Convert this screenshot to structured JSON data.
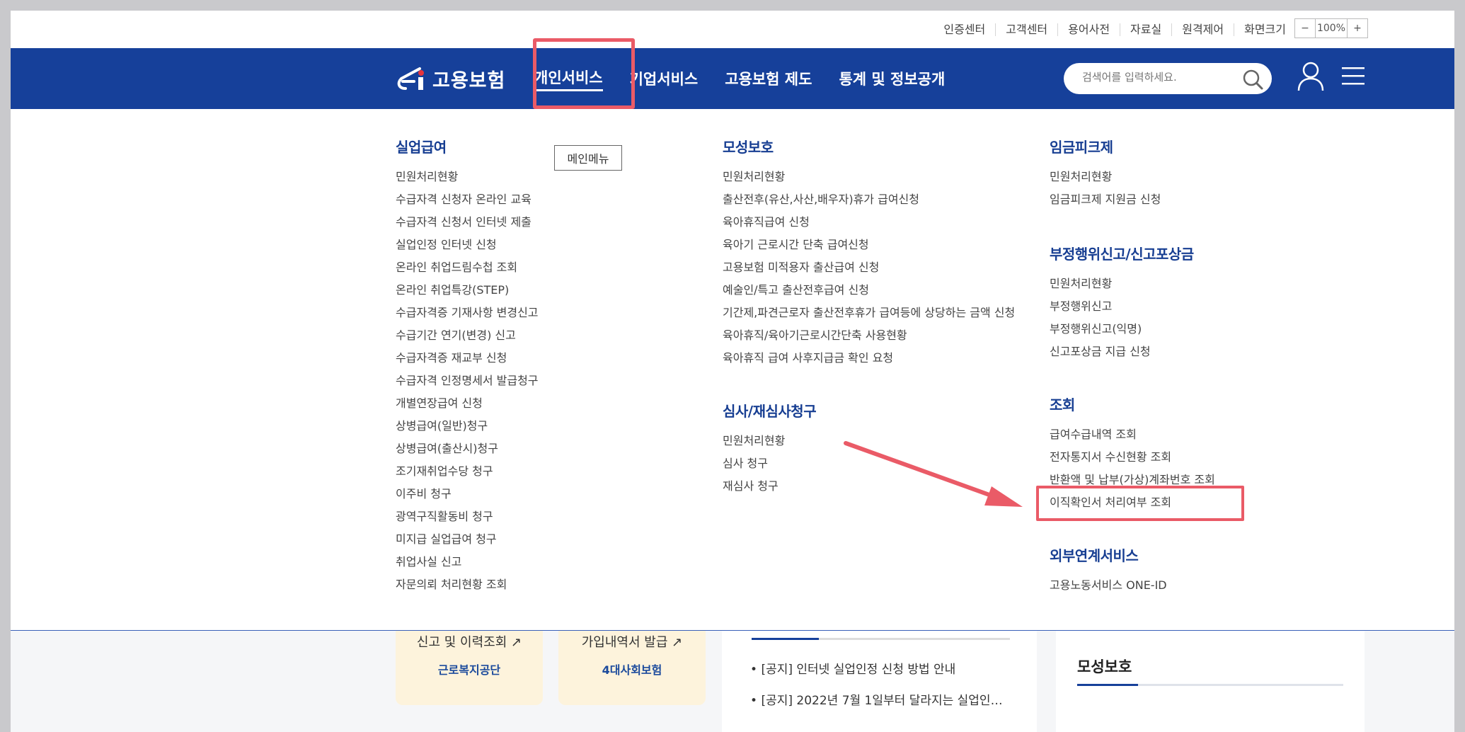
{
  "util_links": [
    "인증센터",
    "고객센터",
    "용어사전",
    "자료실",
    "원격제어",
    "화면크기"
  ],
  "zoom": {
    "minus": "−",
    "value": "100%",
    "plus": "+"
  },
  "logo_text": "고용보험",
  "nav": [
    "개인서비스",
    "기업서비스",
    "고용보험 제도",
    "통계 및 정보공개"
  ],
  "search": {
    "placeholder": "검색어를 입력하세요."
  },
  "main_menu_label": "메인메뉴",
  "menu": {
    "col1": {
      "title": "실업급여",
      "items": [
        "민원처리현황",
        "수급자격 신청자 온라인 교육",
        "수급자격 신청서 인터넷 제출",
        "실업인정 인터넷 신청",
        "온라인 취업드림수첩 조회",
        "온라인 취업특강(STEP)",
        "수급자격증 기재사항 변경신고",
        "수급기간 연기(변경) 신고",
        "수급자격증 재교부 신청",
        "수급자격 인정명세서 발급청구",
        "개별연장급여 신청",
        "상병급여(일반)청구",
        "상병급여(출산시)청구",
        "조기재취업수당 청구",
        "이주비 청구",
        "광역구직활동비 청구",
        "미지급 실업급여 청구",
        "취업사실 신고",
        "자문의뢰 처리현황 조회"
      ]
    },
    "col2a": {
      "title": "모성보호",
      "items": [
        "민원처리현황",
        "출산전후(유산,사산,배우자)휴가 급여신청",
        "육아휴직급여 신청",
        "육아기 근로시간 단축 급여신청",
        "고용보험 미적용자 출산급여 신청",
        "예술인/특고 출산전후급여 신청",
        "기간제,파견근로자 출산전후휴가 급여등에 상당하는 금액 신청",
        "육아휴직/육아기근로시간단축 사용현황",
        "육아휴직 급여 사후지급금 확인 요청"
      ]
    },
    "col2b": {
      "title": "심사/재심사청구",
      "items": [
        "민원처리현황",
        "심사 청구",
        "재심사 청구"
      ]
    },
    "col3a": {
      "title": "임금피크제",
      "items": [
        "민원처리현황",
        "임금피크제 지원금 신청"
      ]
    },
    "col3b": {
      "title": "부정행위신고/신고포상금",
      "items": [
        "민원처리현황",
        "부정행위신고",
        "부정행위신고(익명)",
        "신고포상금 지급 신청"
      ]
    },
    "col3c": {
      "title": "조회",
      "items": [
        "급여수급내역 조회",
        "전자통지서 수신현황 조회",
        "반환액 및 납부(가상)계좌번호 조회",
        "이직확인서 처리여부 조회"
      ]
    },
    "col3d": {
      "title": "외부연계서비스",
      "items": [
        "고용노동서비스 ONE-ID"
      ]
    }
  },
  "bg": {
    "card1_title": "신고 및 이력조회",
    "card1_org": "근로복지공단",
    "card2_title": "가입내역서 발급",
    "card2_org": "4대사회보험",
    "notices": [
      "[공지] 인터넷 실업인정 신청 방법 안내",
      "[공지] 2022년 7월 1일부터 달라지는 실업인…"
    ],
    "side_title": "모성보호"
  },
  "colors": {
    "brand_blue": "#16409a",
    "title_blue": "#173e92",
    "highlight": "#ea5b67"
  }
}
